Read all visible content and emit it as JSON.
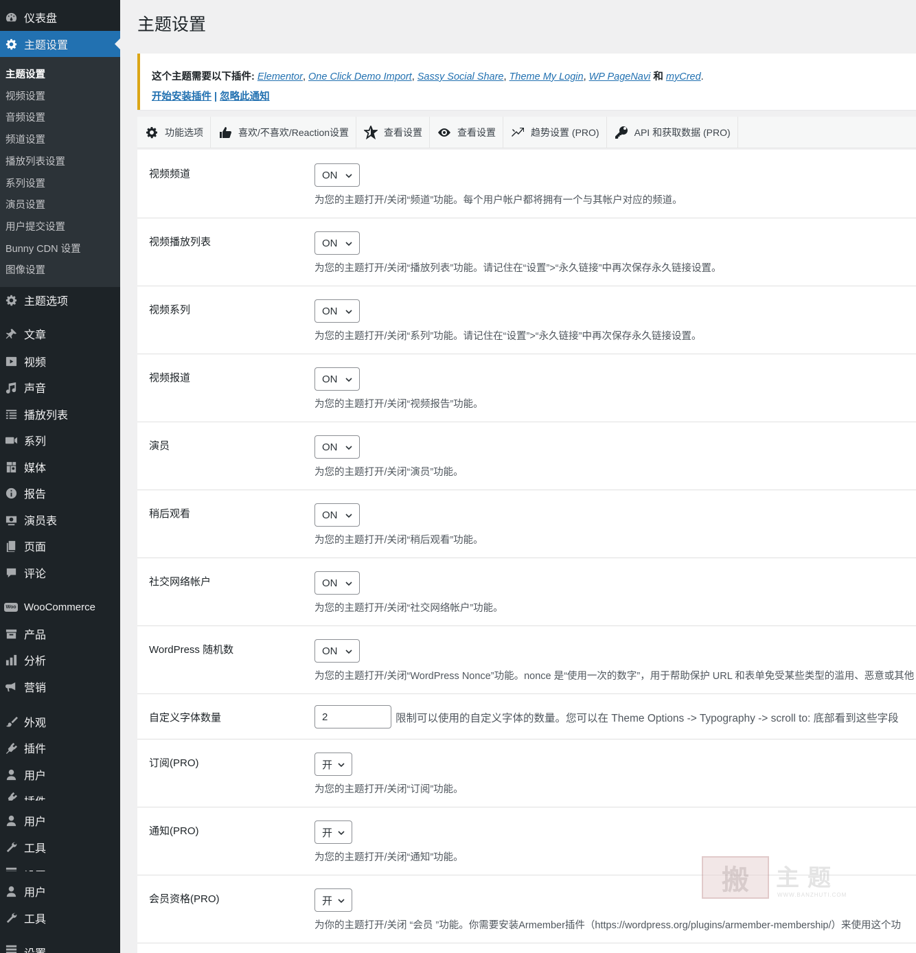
{
  "sidebar": {
    "top_items": [
      {
        "label": "仪表盘",
        "icon": "dashboard-icon"
      },
      {
        "label": "主题设置",
        "icon": "gear-icon"
      }
    ],
    "submenu": [
      "主题设置",
      "视频设置",
      "音频设置",
      "频道设置",
      "播放列表设置",
      "系列设置",
      "演员设置",
      "用户提交设置",
      "Bunny CDN 设置",
      "图像设置"
    ],
    "items": [
      {
        "label": "主题选项",
        "icon": "gear-icon"
      },
      {
        "label": "文章",
        "icon": "pin-icon"
      },
      {
        "label": "视频",
        "icon": "video-icon"
      },
      {
        "label": "声音",
        "icon": "music-icon"
      },
      {
        "label": "播放列表",
        "icon": "playlist-icon"
      },
      {
        "label": "系列",
        "icon": "camera-icon"
      },
      {
        "label": "媒体",
        "icon": "media-icon"
      },
      {
        "label": "报告",
        "icon": "info-icon"
      },
      {
        "label": "演员表",
        "icon": "eye-icon"
      },
      {
        "label": "页面",
        "icon": "page-icon"
      },
      {
        "label": "评论",
        "icon": "comment-icon"
      },
      {
        "label": "WooCommerce",
        "icon": "woo-icon"
      },
      {
        "label": "产品",
        "icon": "archive-icon"
      },
      {
        "label": "分析",
        "icon": "chart-bar-icon"
      },
      {
        "label": "营销",
        "icon": "megaphone-icon"
      },
      {
        "label": "外观",
        "icon": "brush-icon"
      },
      {
        "label": "插件",
        "icon": "plugin-icon"
      },
      {
        "label": "用户",
        "icon": "user-icon"
      },
      {
        "label": "插件",
        "icon": "plugin-icon"
      },
      {
        "label": "用户",
        "icon": "user-icon"
      },
      {
        "label": "工具",
        "icon": "wrench-icon"
      },
      {
        "label": "设置",
        "icon": "settings-icon"
      },
      {
        "label": "用户",
        "icon": "user-icon"
      },
      {
        "label": "工具",
        "icon": "wrench-icon"
      },
      {
        "label": "设置",
        "icon": "settings-icon"
      }
    ]
  },
  "page": {
    "title": "主题设置"
  },
  "notice": {
    "prefix": "这个主题需要以下插件: ",
    "plugins": [
      "Elementor",
      "One Click Demo Import",
      "Sassy Social Share",
      "Theme My Login",
      "WP PageNavi"
    ],
    "and": " 和 ",
    "last_plugin": "myCred",
    "period": ".",
    "install_link": "开始安装插件",
    "divider": " | ",
    "dismiss_link": "忽略此通知"
  },
  "tabs": [
    {
      "label": "功能选项",
      "icon": "gear-icon"
    },
    {
      "label": "喜欢/不喜欢/Reaction设置",
      "icon": "thumbs-up-icon"
    },
    {
      "label": "查看设置",
      "icon": "star-icon"
    },
    {
      "label": "查看设置",
      "icon": "eye-icon"
    },
    {
      "label": "趋势设置 (PRO)",
      "icon": "trending-icon"
    },
    {
      "label": "API 和获取数据 (PRO)",
      "icon": "key-icon"
    }
  ],
  "settings": [
    {
      "label": "视频频道",
      "value": "ON",
      "desc": "为您的主题打开/关闭“频道”功能。每个用户帐户都将拥有一个与其帐户对应的频道。"
    },
    {
      "label": "视频播放列表",
      "value": "ON",
      "desc": "为您的主题打开/关闭“播放列表”功能。请记住在“设置”>“永久链接”中再次保存永久链接设置。"
    },
    {
      "label": "视频系列",
      "value": "ON",
      "desc": "为您的主题打开/关闭“系列”功能。请记住在“设置”>“永久链接”中再次保存永久链接设置。"
    },
    {
      "label": "视频报道",
      "value": "ON",
      "desc": "为您的主题打开/关闭“视频报告”功能。"
    },
    {
      "label": "演员",
      "value": "ON",
      "desc": "为您的主题打开/关闭“演员”功能。"
    },
    {
      "label": "稍后观看",
      "value": "ON",
      "desc": "为您的主题打开/关闭“稍后观看”功能。"
    },
    {
      "label": "社交网络帐户",
      "value": "ON",
      "desc": "为您的主题打开/关闭“社交网络帐户”功能。"
    },
    {
      "label": "WordPress 随机数",
      "value": "ON",
      "desc": "为您的主题打开/关闭“WordPress Nonce”功能。nonce 是“使用一次的数字”，用于帮助保护 URL 和表单免受某些类型的滥用、恶意或其他"
    }
  ],
  "font_count": {
    "label": "自定义字体数量",
    "value": "2",
    "desc": "限制可以使用的自定义字体的数量。您可以在 Theme Options -> Typography -> scroll to: 底部看到这些字段"
  },
  "pro_settings": [
    {
      "label": "订阅(PRO)",
      "value": "开",
      "desc": "为您的主题打开/关闭“订阅”功能。"
    },
    {
      "label": "通知(PRO)",
      "value": "开",
      "desc": "为您的主题打开/关闭“通知”功能。"
    },
    {
      "label": "会员资格(PRO)",
      "value": "开",
      "desc": "为你的主题打开/关闭 “会员 ”功能。你需要安装Armember插件（https://wordpress.org/plugins/armember-membership/）来使用这个功"
    }
  ],
  "watermark": {
    "big": "搬",
    "text": "主题",
    "url": "WWW.BANZHUTI.COM"
  },
  "colors": {
    "sidebar_bg": "#1d2327",
    "submenu_bg": "#2c3338",
    "accent": "#2271b1",
    "notice_border": "#dba617"
  }
}
